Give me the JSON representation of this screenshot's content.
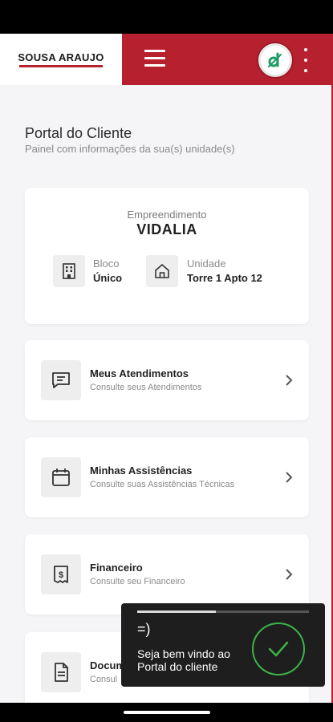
{
  "header": {
    "logo_text": "SOUSA ARAUJO",
    "accent_color": "#b7202e"
  },
  "page": {
    "title": "Portal do Cliente",
    "subtitle": "Painel com informações da sua(s) unidade(s)"
  },
  "info_card": {
    "empreendimento_label": "Empreendimento",
    "empreendimento_value": "VIDALIA",
    "bloco_label": "Bloco",
    "bloco_value": "Único",
    "unidade_label": "Unidade",
    "unidade_value": "Torre 1 Apto 12"
  },
  "nav_items": [
    {
      "title": "Meus Atendimentos",
      "subtitle": "Consulte seus Atendimentos",
      "icon": "message-icon"
    },
    {
      "title": "Minhas Assistências",
      "subtitle": "Consulte suas Assistências Técnicas",
      "icon": "calendar-icon"
    },
    {
      "title": "Financeiro",
      "subtitle": "Consulte seu Financeiro",
      "icon": "invoice-icon"
    },
    {
      "title": "Docum",
      "subtitle": "Consul",
      "icon": "document-icon"
    }
  ],
  "toast": {
    "emoji": "=)",
    "message": "Seja bem vindo ao Portal do cliente",
    "progress": 0.46,
    "check_color": "#3cb34a"
  }
}
